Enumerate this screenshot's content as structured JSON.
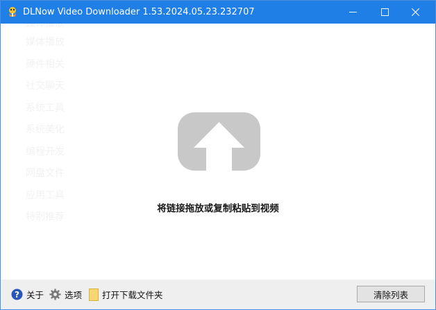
{
  "window": {
    "title": "DLNow Video Downloader 1.53.2024.05.23.232707",
    "controls": {
      "minimize_icon": "minimize-icon",
      "maximize_icon": "maximize-icon",
      "close_icon": "close-icon"
    }
  },
  "main": {
    "drop_hint": "将链接拖放或复制粘贴到视频",
    "drop_icon": "upload-arrow-icon"
  },
  "background_menu": {
    "items": [
      "媒体播放",
      "媒体播放",
      "硬件相关",
      "社交聊天",
      "系统工具",
      "系统美化",
      "编程开发",
      "网盘文件",
      "应用工具",
      "特别推荐"
    ]
  },
  "footer": {
    "about_label": "关于",
    "options_label": "选项",
    "open_folder_label": "打开下载文件夹",
    "clear_list_label": "清除列表"
  },
  "colors": {
    "titlebar": "#1f7fe6",
    "footer": "#efefef",
    "drop_icon": "#c8c8c8"
  }
}
